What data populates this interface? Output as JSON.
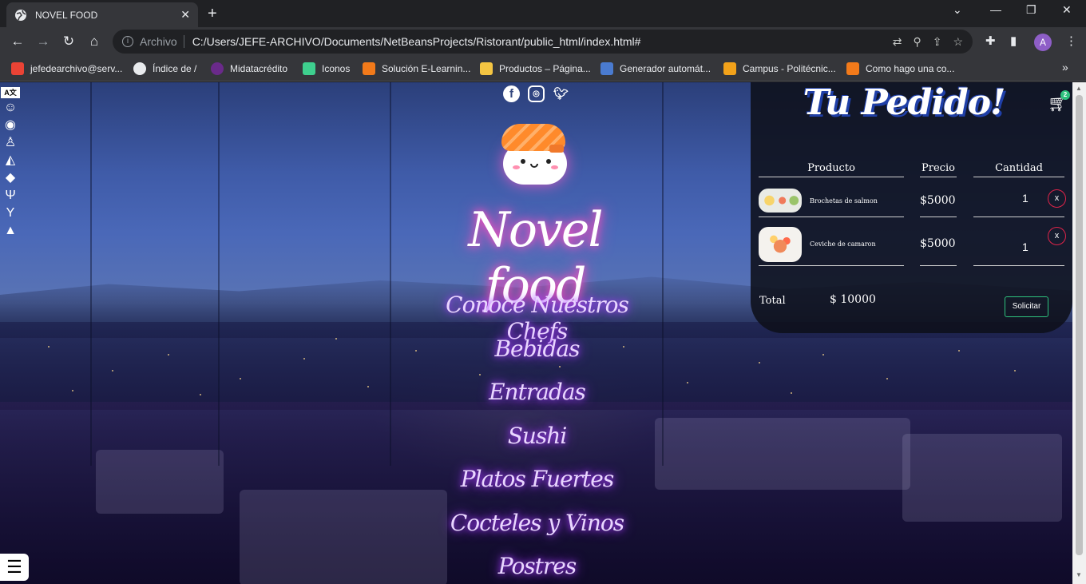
{
  "browser": {
    "tab_title": "NOVEL FOOD",
    "tab_close": "✕",
    "new_tab": "+",
    "window_controls": {
      "minimize": "—",
      "restore": "❐",
      "close": "✕",
      "dropdown": "⌄"
    },
    "scheme_label": "Archivo",
    "url": "C:/Users/JEFE-ARCHIVO/Documents/NetBeansProjects/Ristorant/public_html/index.html#",
    "avatar_letter": "A",
    "bookmarks": [
      {
        "label": "jefedearchivo@serv...",
        "color": "#ea4335"
      },
      {
        "label": "Índice de /",
        "color": "#e8eaed"
      },
      {
        "label": "Midatacrédito",
        "color": "#6a2a8a"
      },
      {
        "label": "Iconos",
        "color": "#3ecf8e"
      },
      {
        "label": "Solución E-Learnin...",
        "color": "#f27a1a"
      },
      {
        "label": "Productos – Página...",
        "color": "#f4c542"
      },
      {
        "label": "Generador automát...",
        "color": "#4a7bd0"
      },
      {
        "label": "Campus - Politécnic...",
        "color": "#f2a21a"
      },
      {
        "label": "Como hago una co...",
        "color": "#f27a1a"
      }
    ]
  },
  "page": {
    "brand": "Novel food",
    "menu": [
      "Conoce Nuestros Chefs",
      "Bebidas",
      "Entradas",
      "Sushi",
      "Platos Fuertes",
      "Cocteles y Vinos",
      "Postres"
    ],
    "left_icons": [
      "translate-icon",
      "chef-icon",
      "podcast-icon",
      "drinks-icon",
      "pizza-icon",
      "fish-icon",
      "utensils-icon",
      "cocktail-icon",
      "dessert-icon"
    ]
  },
  "order": {
    "title": "Tu Pedido!",
    "cart_count": "2",
    "headers": {
      "product": "Producto",
      "price": "Precio",
      "quantity": "Cantidad"
    },
    "items": [
      {
        "name": "Brochetas de salmon",
        "price": "$5000",
        "qty": "1",
        "remove": "x"
      },
      {
        "name": "Ceviche de camaron",
        "price": "$5000",
        "qty": "1",
        "remove": "x"
      }
    ],
    "total_label": "Total",
    "total_value": "$ 10000",
    "submit_label": "Solicitar"
  }
}
